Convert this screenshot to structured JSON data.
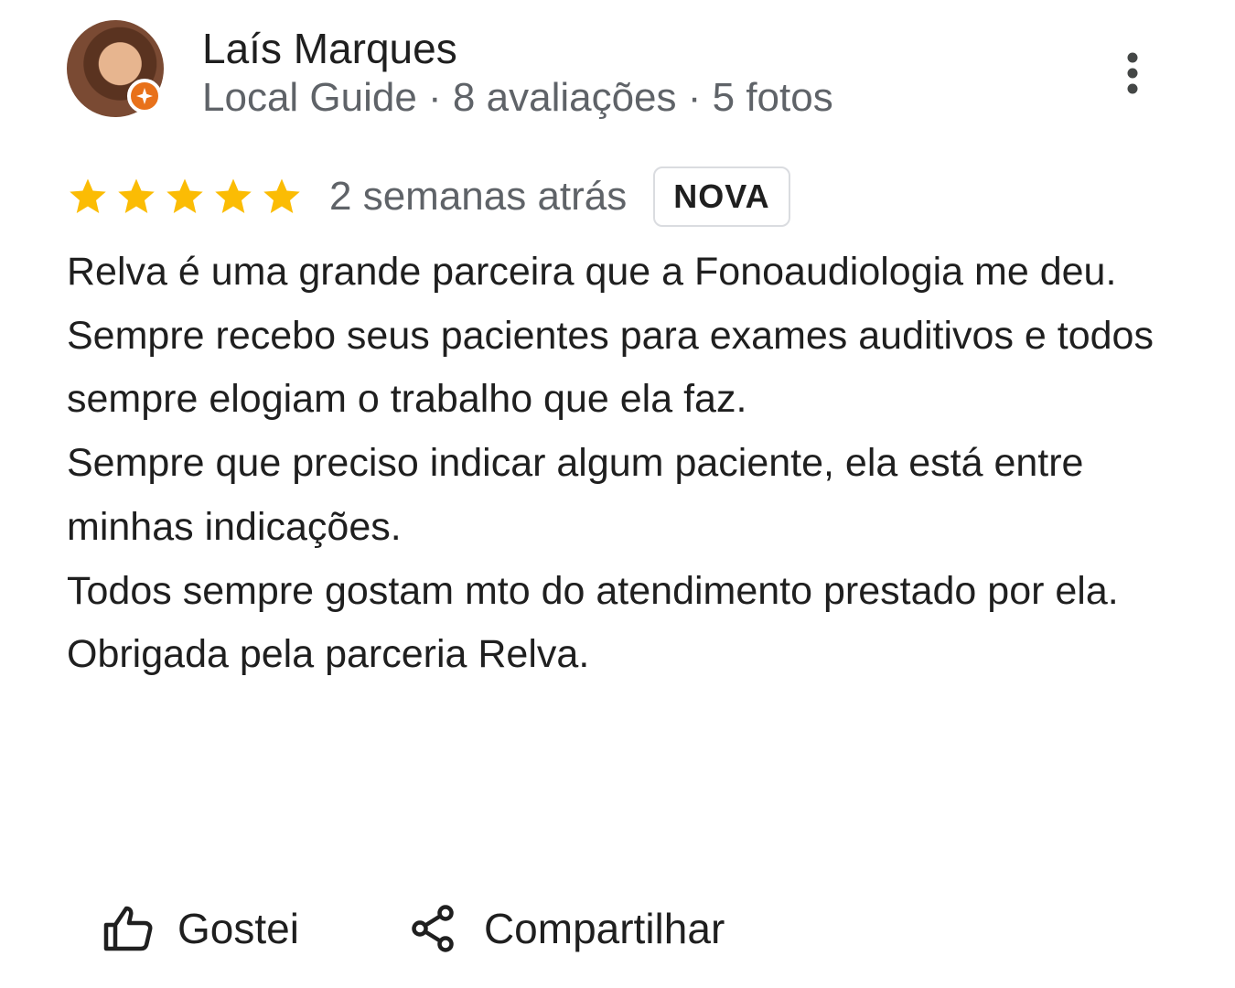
{
  "reviewer": {
    "name": "Laís Marques",
    "meta": "Local Guide · 8 avaliações · 5 fotos"
  },
  "review": {
    "rating": 5,
    "max_rating": 5,
    "date": "2 semanas atrás",
    "badge": "NOVA",
    "paragraphs": [
      "Relva é uma grande parceira que a Fonoaudiologia me deu. Sempre recebo seus pacientes para exames auditivos e todos sempre elogiam o trabalho que ela faz.",
      "Sempre que preciso indicar algum paciente, ela está entre minhas indicações.",
      "Todos sempre gostam mto do atendimento prestado por ela.",
      "Obrigada pela parceria Relva."
    ]
  },
  "actions": {
    "like_label": "Gostei",
    "share_label": "Compartilhar"
  },
  "icons": {
    "avatar_badge": "local-guide-icon",
    "menu": "more-vert-icon",
    "star": "star-icon",
    "like": "thumb-up-icon",
    "share": "share-icon"
  },
  "colors": {
    "star": "#fbbc04",
    "guide_badge": "#e8711a",
    "secondary_text": "#5f6368",
    "primary_text": "#1f1f1f"
  }
}
